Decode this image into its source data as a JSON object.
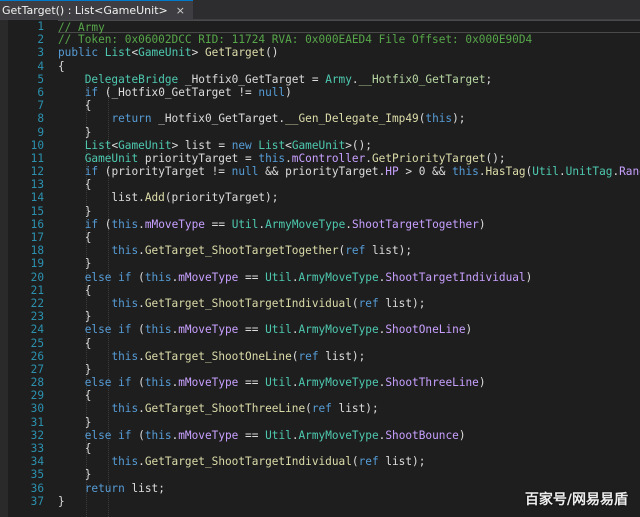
{
  "tab": {
    "title": "GetTarget() : List<GameUnit>",
    "close_glyph": "×"
  },
  "watermark": "百家号/网易易盾",
  "lines": [
    {
      "num": "1",
      "tokens": [
        [
          "c",
          "// Army"
        ]
      ]
    },
    {
      "num": "2",
      "tokens": [
        [
          "c",
          "// Token: 0x06002DCC RID: 11724 RVA: 0x000EAED4 File Offset: 0x000E90D4"
        ]
      ]
    },
    {
      "num": "3",
      "tokens": [
        [
          "k",
          "public "
        ],
        [
          "t",
          "List"
        ],
        [
          "p",
          "<"
        ],
        [
          "t",
          "GameUnit"
        ],
        [
          "p",
          "> "
        ],
        [
          "m",
          "GetTarget"
        ],
        [
          "p",
          "()"
        ]
      ]
    },
    {
      "num": "4",
      "tokens": [
        [
          "p",
          "{"
        ]
      ]
    },
    {
      "num": "5",
      "tokens": [
        [
          "p",
          "    "
        ],
        [
          "t",
          "DelegateBridge"
        ],
        [
          "p",
          " _Hotfix0_GetTarget = "
        ],
        [
          "t",
          "Army"
        ],
        [
          "p",
          "."
        ],
        [
          "e",
          "__Hotfix0_GetTarget"
        ],
        [
          "p",
          ";"
        ]
      ]
    },
    {
      "num": "6",
      "tokens": [
        [
          "p",
          "    "
        ],
        [
          "k",
          "if "
        ],
        [
          "p",
          "(_Hotfix0_GetTarget != "
        ],
        [
          "k",
          "null"
        ],
        [
          "p",
          ")"
        ]
      ]
    },
    {
      "num": "7",
      "tokens": [
        [
          "p",
          "    {"
        ]
      ]
    },
    {
      "num": "8",
      "tokens": [
        [
          "p",
          "        "
        ],
        [
          "k",
          "return "
        ],
        [
          "p",
          "_Hotfix0_GetTarget."
        ],
        [
          "m",
          "__Gen_Delegate_Imp49"
        ],
        [
          "p",
          "("
        ],
        [
          "k",
          "this"
        ],
        [
          "p",
          ");"
        ]
      ]
    },
    {
      "num": "9",
      "tokens": [
        [
          "p",
          "    }"
        ]
      ]
    },
    {
      "num": "10",
      "tokens": [
        [
          "p",
          "    "
        ],
        [
          "t",
          "List"
        ],
        [
          "p",
          "<"
        ],
        [
          "t",
          "GameUnit"
        ],
        [
          "p",
          "> list = "
        ],
        [
          "k",
          "new "
        ],
        [
          "t",
          "List"
        ],
        [
          "p",
          "<"
        ],
        [
          "t",
          "GameUnit"
        ],
        [
          "p",
          ">();"
        ]
      ]
    },
    {
      "num": "11",
      "tokens": [
        [
          "p",
          "    "
        ],
        [
          "t",
          "GameUnit"
        ],
        [
          "p",
          " priorityTarget = "
        ],
        [
          "k",
          "this"
        ],
        [
          "p",
          "."
        ],
        [
          "f",
          "mController"
        ],
        [
          "p",
          "."
        ],
        [
          "m",
          "GetPriorityTarget"
        ],
        [
          "p",
          "();"
        ]
      ]
    },
    {
      "num": "12",
      "tokens": [
        [
          "p",
          "    "
        ],
        [
          "k",
          "if "
        ],
        [
          "p",
          "(priorityTarget != "
        ],
        [
          "k",
          "null"
        ],
        [
          "p",
          " && priorityTarget."
        ],
        [
          "f",
          "HP"
        ],
        [
          "p",
          " > 0 && "
        ],
        [
          "k",
          "this"
        ],
        [
          "p",
          "."
        ],
        [
          "m",
          "HasTag"
        ],
        [
          "p",
          "("
        ],
        [
          "t",
          "Util"
        ],
        [
          "p",
          "."
        ],
        [
          "t",
          "UnitTag"
        ],
        [
          "p",
          "."
        ],
        [
          "f",
          "Ranger"
        ],
        [
          "p",
          "))"
        ]
      ]
    },
    {
      "num": "13",
      "tokens": [
        [
          "p",
          "    {"
        ]
      ]
    },
    {
      "num": "14",
      "tokens": [
        [
          "p",
          "        list."
        ],
        [
          "m",
          "Add"
        ],
        [
          "p",
          "(priorityTarget);"
        ]
      ]
    },
    {
      "num": "15",
      "tokens": [
        [
          "p",
          "    }"
        ]
      ]
    },
    {
      "num": "16",
      "tokens": [
        [
          "p",
          "    "
        ],
        [
          "k",
          "if "
        ],
        [
          "p",
          "("
        ],
        [
          "k",
          "this"
        ],
        [
          "p",
          "."
        ],
        [
          "f",
          "mMoveType"
        ],
        [
          "p",
          " == "
        ],
        [
          "t",
          "Util"
        ],
        [
          "p",
          "."
        ],
        [
          "t",
          "ArmyMoveType"
        ],
        [
          "p",
          "."
        ],
        [
          "f",
          "ShootTargetTogether"
        ],
        [
          "p",
          ")"
        ]
      ]
    },
    {
      "num": "17",
      "tokens": [
        [
          "p",
          "    {"
        ]
      ]
    },
    {
      "num": "18",
      "tokens": [
        [
          "p",
          "        "
        ],
        [
          "k",
          "this"
        ],
        [
          "p",
          "."
        ],
        [
          "m",
          "GetTarget_ShootTargetTogether"
        ],
        [
          "p",
          "("
        ],
        [
          "k",
          "ref "
        ],
        [
          "p",
          "list);"
        ]
      ]
    },
    {
      "num": "19",
      "tokens": [
        [
          "p",
          "    }"
        ]
      ]
    },
    {
      "num": "20",
      "tokens": [
        [
          "p",
          "    "
        ],
        [
          "k",
          "else if "
        ],
        [
          "p",
          "("
        ],
        [
          "k",
          "this"
        ],
        [
          "p",
          "."
        ],
        [
          "f",
          "mMoveType"
        ],
        [
          "p",
          " == "
        ],
        [
          "t",
          "Util"
        ],
        [
          "p",
          "."
        ],
        [
          "t",
          "ArmyMoveType"
        ],
        [
          "p",
          "."
        ],
        [
          "f",
          "ShootTargetIndividual"
        ],
        [
          "p",
          ")"
        ]
      ]
    },
    {
      "num": "21",
      "tokens": [
        [
          "p",
          "    {"
        ]
      ]
    },
    {
      "num": "22",
      "tokens": [
        [
          "p",
          "        "
        ],
        [
          "k",
          "this"
        ],
        [
          "p",
          "."
        ],
        [
          "m",
          "GetTarget_ShootTargetIndividual"
        ],
        [
          "p",
          "("
        ],
        [
          "k",
          "ref "
        ],
        [
          "p",
          "list);"
        ]
      ]
    },
    {
      "num": "23",
      "tokens": [
        [
          "p",
          "    }"
        ]
      ]
    },
    {
      "num": "24",
      "tokens": [
        [
          "p",
          "    "
        ],
        [
          "k",
          "else if "
        ],
        [
          "p",
          "("
        ],
        [
          "k",
          "this"
        ],
        [
          "p",
          "."
        ],
        [
          "f",
          "mMoveType"
        ],
        [
          "p",
          " == "
        ],
        [
          "t",
          "Util"
        ],
        [
          "p",
          "."
        ],
        [
          "t",
          "ArmyMoveType"
        ],
        [
          "p",
          "."
        ],
        [
          "f",
          "ShootOneLine"
        ],
        [
          "p",
          ")"
        ]
      ]
    },
    {
      "num": "25",
      "tokens": [
        [
          "p",
          "    {"
        ]
      ]
    },
    {
      "num": "26",
      "tokens": [
        [
          "p",
          "        "
        ],
        [
          "k",
          "this"
        ],
        [
          "p",
          "."
        ],
        [
          "m",
          "GetTarget_ShootOneLine"
        ],
        [
          "p",
          "("
        ],
        [
          "k",
          "ref "
        ],
        [
          "p",
          "list);"
        ]
      ]
    },
    {
      "num": "27",
      "tokens": [
        [
          "p",
          "    }"
        ]
      ]
    },
    {
      "num": "28",
      "tokens": [
        [
          "p",
          "    "
        ],
        [
          "k",
          "else if "
        ],
        [
          "p",
          "("
        ],
        [
          "k",
          "this"
        ],
        [
          "p",
          "."
        ],
        [
          "f",
          "mMoveType"
        ],
        [
          "p",
          " == "
        ],
        [
          "t",
          "Util"
        ],
        [
          "p",
          "."
        ],
        [
          "t",
          "ArmyMoveType"
        ],
        [
          "p",
          "."
        ],
        [
          "f",
          "ShootThreeLine"
        ],
        [
          "p",
          ")"
        ]
      ]
    },
    {
      "num": "29",
      "tokens": [
        [
          "p",
          "    {"
        ]
      ]
    },
    {
      "num": "30",
      "tokens": [
        [
          "p",
          "        "
        ],
        [
          "k",
          "this"
        ],
        [
          "p",
          "."
        ],
        [
          "m",
          "GetTarget_ShootThreeLine"
        ],
        [
          "p",
          "("
        ],
        [
          "k",
          "ref "
        ],
        [
          "p",
          "list);"
        ]
      ]
    },
    {
      "num": "31",
      "tokens": [
        [
          "p",
          "    }"
        ]
      ]
    },
    {
      "num": "32",
      "tokens": [
        [
          "p",
          "    "
        ],
        [
          "k",
          "else if "
        ],
        [
          "p",
          "("
        ],
        [
          "k",
          "this"
        ],
        [
          "p",
          "."
        ],
        [
          "f",
          "mMoveType"
        ],
        [
          "p",
          " == "
        ],
        [
          "t",
          "Util"
        ],
        [
          "p",
          "."
        ],
        [
          "t",
          "ArmyMoveType"
        ],
        [
          "p",
          "."
        ],
        [
          "f",
          "ShootBounce"
        ],
        [
          "p",
          ")"
        ]
      ]
    },
    {
      "num": "33",
      "tokens": [
        [
          "p",
          "    {"
        ]
      ]
    },
    {
      "num": "34",
      "tokens": [
        [
          "p",
          "        "
        ],
        [
          "k",
          "this"
        ],
        [
          "p",
          "."
        ],
        [
          "m",
          "GetTarget_ShootTargetIndividual"
        ],
        [
          "p",
          "("
        ],
        [
          "k",
          "ref "
        ],
        [
          "p",
          "list);"
        ]
      ]
    },
    {
      "num": "35",
      "tokens": [
        [
          "p",
          "    }"
        ]
      ]
    },
    {
      "num": "36",
      "tokens": [
        [
          "p",
          "    "
        ],
        [
          "k",
          "return "
        ],
        [
          "p",
          "list;"
        ]
      ]
    },
    {
      "num": "37",
      "tokens": [
        [
          "p",
          "}"
        ]
      ]
    }
  ]
}
